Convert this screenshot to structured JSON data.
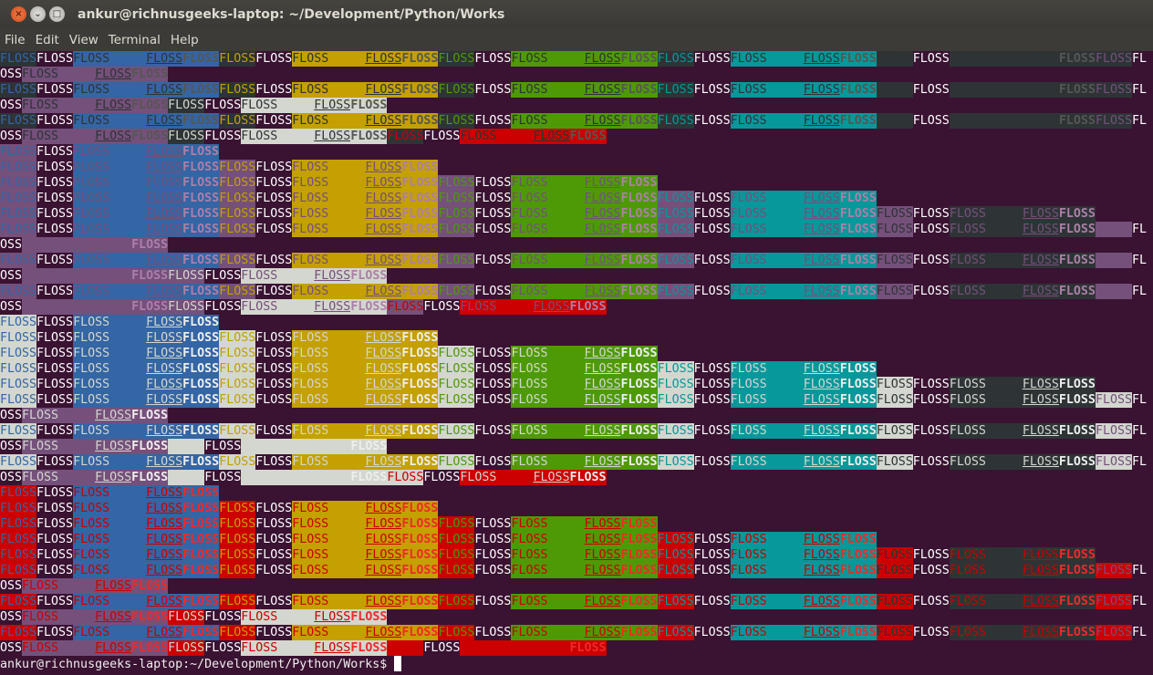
{
  "window": {
    "title": "ankur@richnusgeeks-laptop: ~/Development/Python/Works",
    "buttons": {
      "close": "×",
      "minimize": "⌄",
      "maximize": "□"
    }
  },
  "menu": [
    "File",
    "Edit",
    "View",
    "Terminal",
    "Help"
  ],
  "terminal": {
    "columns": 157,
    "sample_text": "FLOSS",
    "default_bg": "#3a1232",
    "default_fg": "#ffffff",
    "palette": {
      "blue": "#3465a4",
      "yellow": "#c4a000",
      "green": "#4e9a06",
      "cyan": "#06989a",
      "black": "#2e3436",
      "magenta": "#75507b",
      "white": "#d3d7cf",
      "red": "#cc0000"
    },
    "bold_palette": {
      "black": "#555753",
      "magenta": "#ad7fa8",
      "white": "#eeeeec",
      "red": "#ef2929"
    },
    "background_order": [
      "blue",
      "yellow",
      "green",
      "cyan",
      "black",
      "magenta",
      "white",
      "red"
    ],
    "groups": [
      {
        "fg": "black",
        "first_row": 6
      },
      {
        "fg": "magenta",
        "first_row": 1
      },
      {
        "fg": "white",
        "first_row": 1
      },
      {
        "fg": "red",
        "first_row": 1
      }
    ],
    "prompt": "ankur@richnusgeeks-laptop:~/Development/Python/Works$ "
  }
}
